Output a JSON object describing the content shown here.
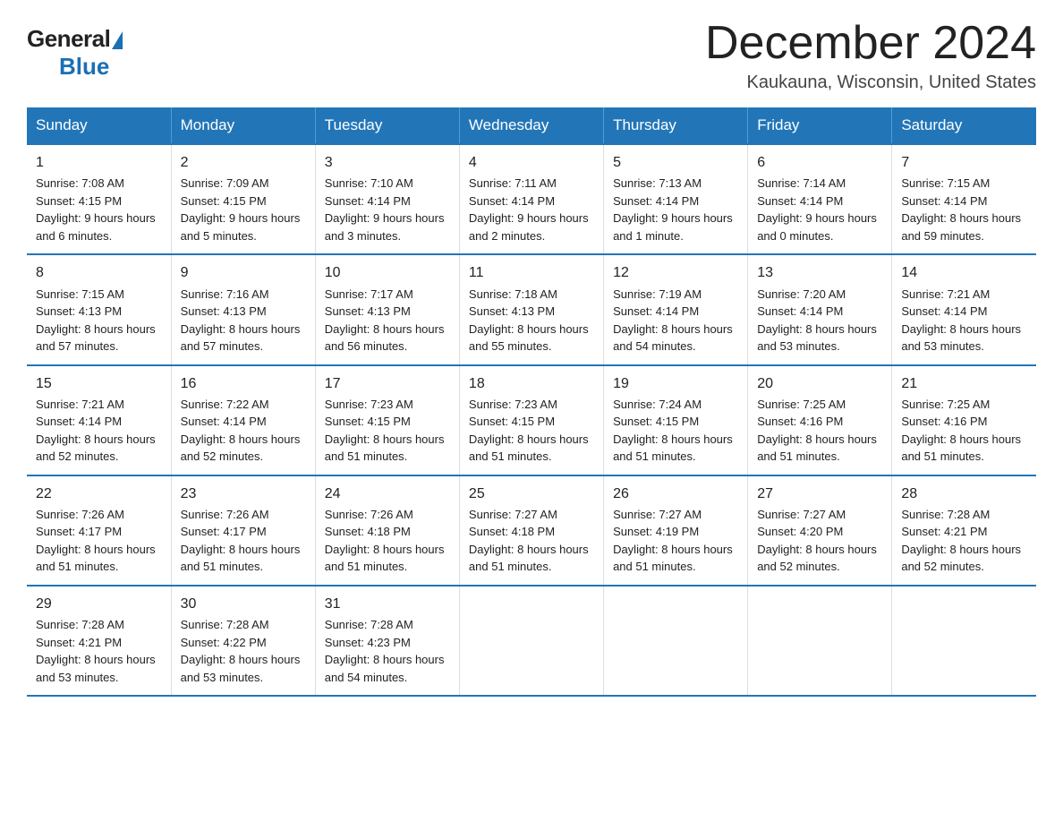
{
  "logo": {
    "general": "General",
    "blue": "Blue"
  },
  "title": {
    "month_year": "December 2024",
    "location": "Kaukauna, Wisconsin, United States"
  },
  "headers": [
    "Sunday",
    "Monday",
    "Tuesday",
    "Wednesday",
    "Thursday",
    "Friday",
    "Saturday"
  ],
  "weeks": [
    [
      {
        "day": "1",
        "sunrise": "7:08 AM",
        "sunset": "4:15 PM",
        "daylight": "9 hours and 6 minutes."
      },
      {
        "day": "2",
        "sunrise": "7:09 AM",
        "sunset": "4:15 PM",
        "daylight": "9 hours and 5 minutes."
      },
      {
        "day": "3",
        "sunrise": "7:10 AM",
        "sunset": "4:14 PM",
        "daylight": "9 hours and 3 minutes."
      },
      {
        "day": "4",
        "sunrise": "7:11 AM",
        "sunset": "4:14 PM",
        "daylight": "9 hours and 2 minutes."
      },
      {
        "day": "5",
        "sunrise": "7:13 AM",
        "sunset": "4:14 PM",
        "daylight": "9 hours and 1 minute."
      },
      {
        "day": "6",
        "sunrise": "7:14 AM",
        "sunset": "4:14 PM",
        "daylight": "9 hours and 0 minutes."
      },
      {
        "day": "7",
        "sunrise": "7:15 AM",
        "sunset": "4:14 PM",
        "daylight": "8 hours and 59 minutes."
      }
    ],
    [
      {
        "day": "8",
        "sunrise": "7:15 AM",
        "sunset": "4:13 PM",
        "daylight": "8 hours and 57 minutes."
      },
      {
        "day": "9",
        "sunrise": "7:16 AM",
        "sunset": "4:13 PM",
        "daylight": "8 hours and 57 minutes."
      },
      {
        "day": "10",
        "sunrise": "7:17 AM",
        "sunset": "4:13 PM",
        "daylight": "8 hours and 56 minutes."
      },
      {
        "day": "11",
        "sunrise": "7:18 AM",
        "sunset": "4:13 PM",
        "daylight": "8 hours and 55 minutes."
      },
      {
        "day": "12",
        "sunrise": "7:19 AM",
        "sunset": "4:14 PM",
        "daylight": "8 hours and 54 minutes."
      },
      {
        "day": "13",
        "sunrise": "7:20 AM",
        "sunset": "4:14 PM",
        "daylight": "8 hours and 53 minutes."
      },
      {
        "day": "14",
        "sunrise": "7:21 AM",
        "sunset": "4:14 PM",
        "daylight": "8 hours and 53 minutes."
      }
    ],
    [
      {
        "day": "15",
        "sunrise": "7:21 AM",
        "sunset": "4:14 PM",
        "daylight": "8 hours and 52 minutes."
      },
      {
        "day": "16",
        "sunrise": "7:22 AM",
        "sunset": "4:14 PM",
        "daylight": "8 hours and 52 minutes."
      },
      {
        "day": "17",
        "sunrise": "7:23 AM",
        "sunset": "4:15 PM",
        "daylight": "8 hours and 51 minutes."
      },
      {
        "day": "18",
        "sunrise": "7:23 AM",
        "sunset": "4:15 PM",
        "daylight": "8 hours and 51 minutes."
      },
      {
        "day": "19",
        "sunrise": "7:24 AM",
        "sunset": "4:15 PM",
        "daylight": "8 hours and 51 minutes."
      },
      {
        "day": "20",
        "sunrise": "7:25 AM",
        "sunset": "4:16 PM",
        "daylight": "8 hours and 51 minutes."
      },
      {
        "day": "21",
        "sunrise": "7:25 AM",
        "sunset": "4:16 PM",
        "daylight": "8 hours and 51 minutes."
      }
    ],
    [
      {
        "day": "22",
        "sunrise": "7:26 AM",
        "sunset": "4:17 PM",
        "daylight": "8 hours and 51 minutes."
      },
      {
        "day": "23",
        "sunrise": "7:26 AM",
        "sunset": "4:17 PM",
        "daylight": "8 hours and 51 minutes."
      },
      {
        "day": "24",
        "sunrise": "7:26 AM",
        "sunset": "4:18 PM",
        "daylight": "8 hours and 51 minutes."
      },
      {
        "day": "25",
        "sunrise": "7:27 AM",
        "sunset": "4:18 PM",
        "daylight": "8 hours and 51 minutes."
      },
      {
        "day": "26",
        "sunrise": "7:27 AM",
        "sunset": "4:19 PM",
        "daylight": "8 hours and 51 minutes."
      },
      {
        "day": "27",
        "sunrise": "7:27 AM",
        "sunset": "4:20 PM",
        "daylight": "8 hours and 52 minutes."
      },
      {
        "day": "28",
        "sunrise": "7:28 AM",
        "sunset": "4:21 PM",
        "daylight": "8 hours and 52 minutes."
      }
    ],
    [
      {
        "day": "29",
        "sunrise": "7:28 AM",
        "sunset": "4:21 PM",
        "daylight": "8 hours and 53 minutes."
      },
      {
        "day": "30",
        "sunrise": "7:28 AM",
        "sunset": "4:22 PM",
        "daylight": "8 hours and 53 minutes."
      },
      {
        "day": "31",
        "sunrise": "7:28 AM",
        "sunset": "4:23 PM",
        "daylight": "8 hours and 54 minutes."
      },
      null,
      null,
      null,
      null
    ]
  ],
  "labels": {
    "sunrise": "Sunrise:",
    "sunset": "Sunset:",
    "daylight": "Daylight:"
  }
}
